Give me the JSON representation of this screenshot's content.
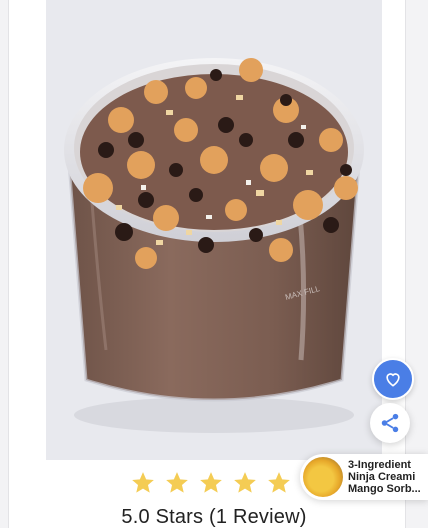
{
  "recipe_image": {
    "jar_label": "MAX FILL"
  },
  "rating": {
    "stars_filled": 5,
    "stars_total": 5,
    "star_color": "#f4cc54",
    "text": "5.0 Stars (1 Review)"
  },
  "actions": {
    "favorite_icon": "heart-icon",
    "favorite_color": "#4a7ee6",
    "share_icon": "share-icon",
    "share_color": "#4a7ee6"
  },
  "recommendation": {
    "title": "3-Ingredient Ninja Creami Mango Sorb..."
  }
}
